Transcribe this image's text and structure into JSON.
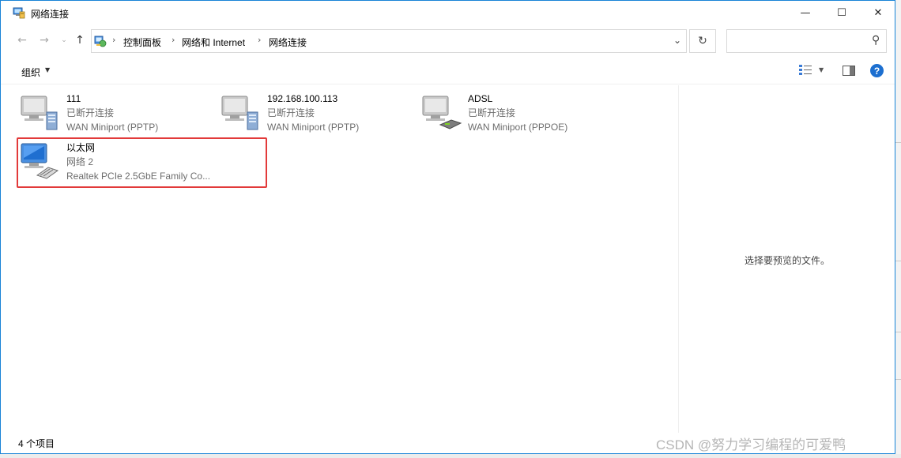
{
  "window": {
    "title": "网络连接",
    "title_icon": "network-connections-icon",
    "controls": {
      "minimize": "—",
      "maximize": "☐",
      "close": "✕"
    }
  },
  "nav": {
    "back_icon": "back-arrow-icon",
    "forward_icon": "forward-arrow-icon",
    "recent_icon": "chevron-down-icon",
    "up_icon": "up-arrow-icon"
  },
  "address": {
    "breadcrumbs": [
      "控制面板",
      "网络和 Internet",
      "网络连接"
    ],
    "separator": "›",
    "dropdown_icon": "chevron-down-icon",
    "refresh_icon": "refresh-icon"
  },
  "search": {
    "placeholder": "",
    "icon": "search-icon"
  },
  "toolbar": {
    "organize_label": "组织",
    "view_icon": "view-options-icon",
    "preview_pane_icon": "preview-pane-icon",
    "help_label": "?"
  },
  "connections": [
    {
      "name": "111",
      "status": "已断开连接",
      "device": "WAN Miniport (PPTP)",
      "icon": "vpn-connection-icon"
    },
    {
      "name": "192.168.100.113",
      "status": "已断开连接",
      "device": "WAN Miniport (PPTP)",
      "icon": "vpn-connection-icon"
    },
    {
      "name": "ADSL",
      "status": "已断开连接",
      "device": "WAN Miniport (PPPOE)",
      "icon": "broadband-connection-icon"
    },
    {
      "name": "以太网",
      "status": "网络 2",
      "device": "Realtek PCIe 2.5GbE Family Co...",
      "icon": "ethernet-connection-icon",
      "highlighted": true
    }
  ],
  "preview_pane": {
    "message": "选择要预览的文件。"
  },
  "statusbar": {
    "count": "4 个项目"
  },
  "watermark": "CSDN @努力学习编程的可爱鸭",
  "colors": {
    "highlight_border": "#e23a3a",
    "accent": "#1883d7"
  }
}
